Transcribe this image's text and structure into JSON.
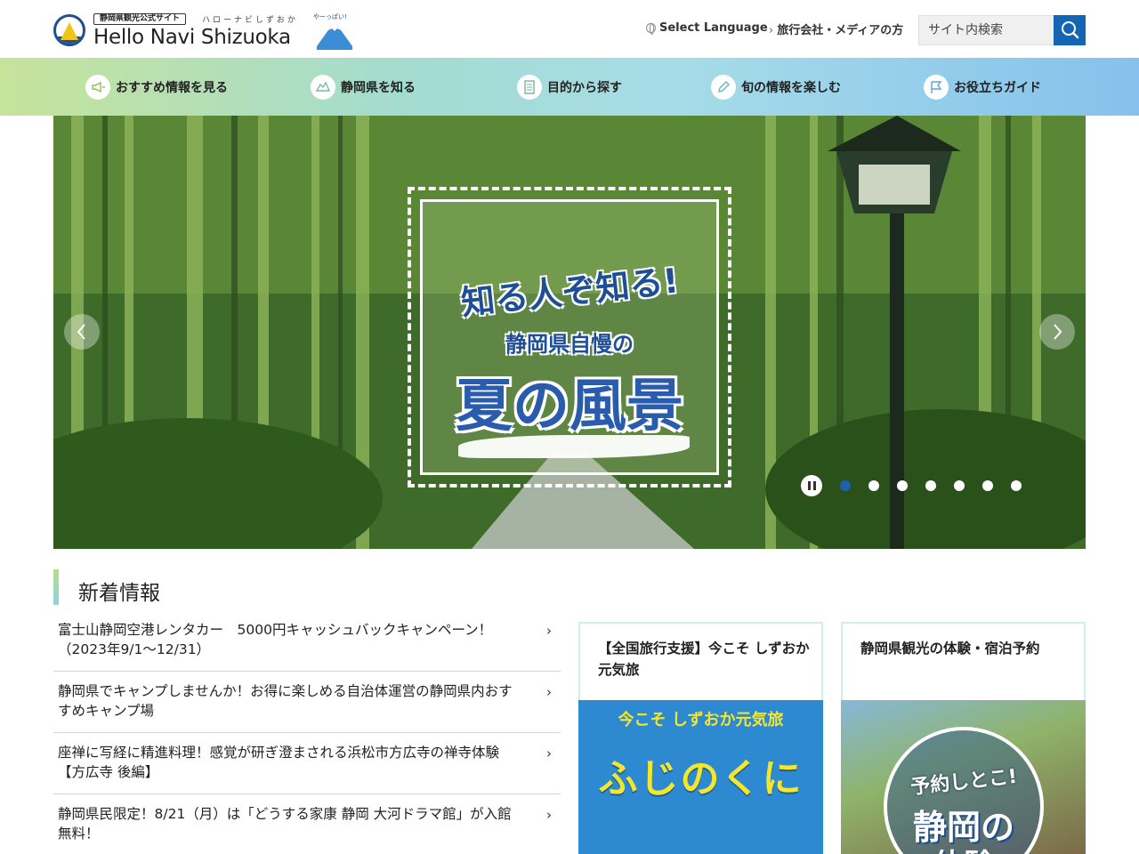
{
  "header": {
    "logo_badge": "静岡県観光公式サイト",
    "logo_kana": "ハローナビしずおか",
    "logo_name": "Hello Navi Shizuoka",
    "logo_mascot_text": "やーっぱい!",
    "language_label": "Select Language",
    "agent_media_link": "旅行会社・メディアの方",
    "search_placeholder": "サイト内検索"
  },
  "nav": {
    "items": [
      {
        "label": "おすすめ情報を見る",
        "icon": "megaphone-icon"
      },
      {
        "label": "静岡県を知る",
        "icon": "map-icon"
      },
      {
        "label": "目的から探す",
        "icon": "list-icon"
      },
      {
        "label": "旬の情報を楽しむ",
        "icon": "pencil-icon"
      },
      {
        "label": "お役立ちガイド",
        "icon": "flag-icon"
      }
    ]
  },
  "hero": {
    "line1": "知る人ぞ知る!",
    "line2": "静岡県自慢の",
    "line3": "夏の風景",
    "slide_count": 7,
    "active_slide": 1
  },
  "news": {
    "heading": "新着情報",
    "items": [
      {
        "text": "富士山静岡空港レンタカー　5000円キャッシュバックキャンペーン！（2023年9/1～12/31）"
      },
      {
        "text": "静岡県でキャンプしませんか！お得に楽しめる自治体運営の静岡県内おすすめキャンプ場"
      },
      {
        "text": "座禅に写経に精進料理！感覚が研ぎ澄まされる浜松市方広寺の禅寺体験【方広寺 後編】"
      },
      {
        "text": "静岡県民限定！8/21（月）は「どうする家康 静岡 大河ドラマ館」が入館無料！"
      }
    ]
  },
  "cards": [
    {
      "title": "【全国旅行支援】今こそ しずおか元気旅",
      "banner_sub": "今こそ しずおか元気旅",
      "banner_main": "ふじのくに"
    },
    {
      "title": "静岡県観光の体験・宿泊予約",
      "banner_t1": "予約しとこ!",
      "banner_t2": "静岡の",
      "banner_t3": "体験"
    }
  ],
  "colors": {
    "accent": "#1565b5",
    "active_dot": "#1e5fb0",
    "nav_gradient_start": "#c6e39a",
    "nav_gradient_end": "#85c1ec"
  }
}
